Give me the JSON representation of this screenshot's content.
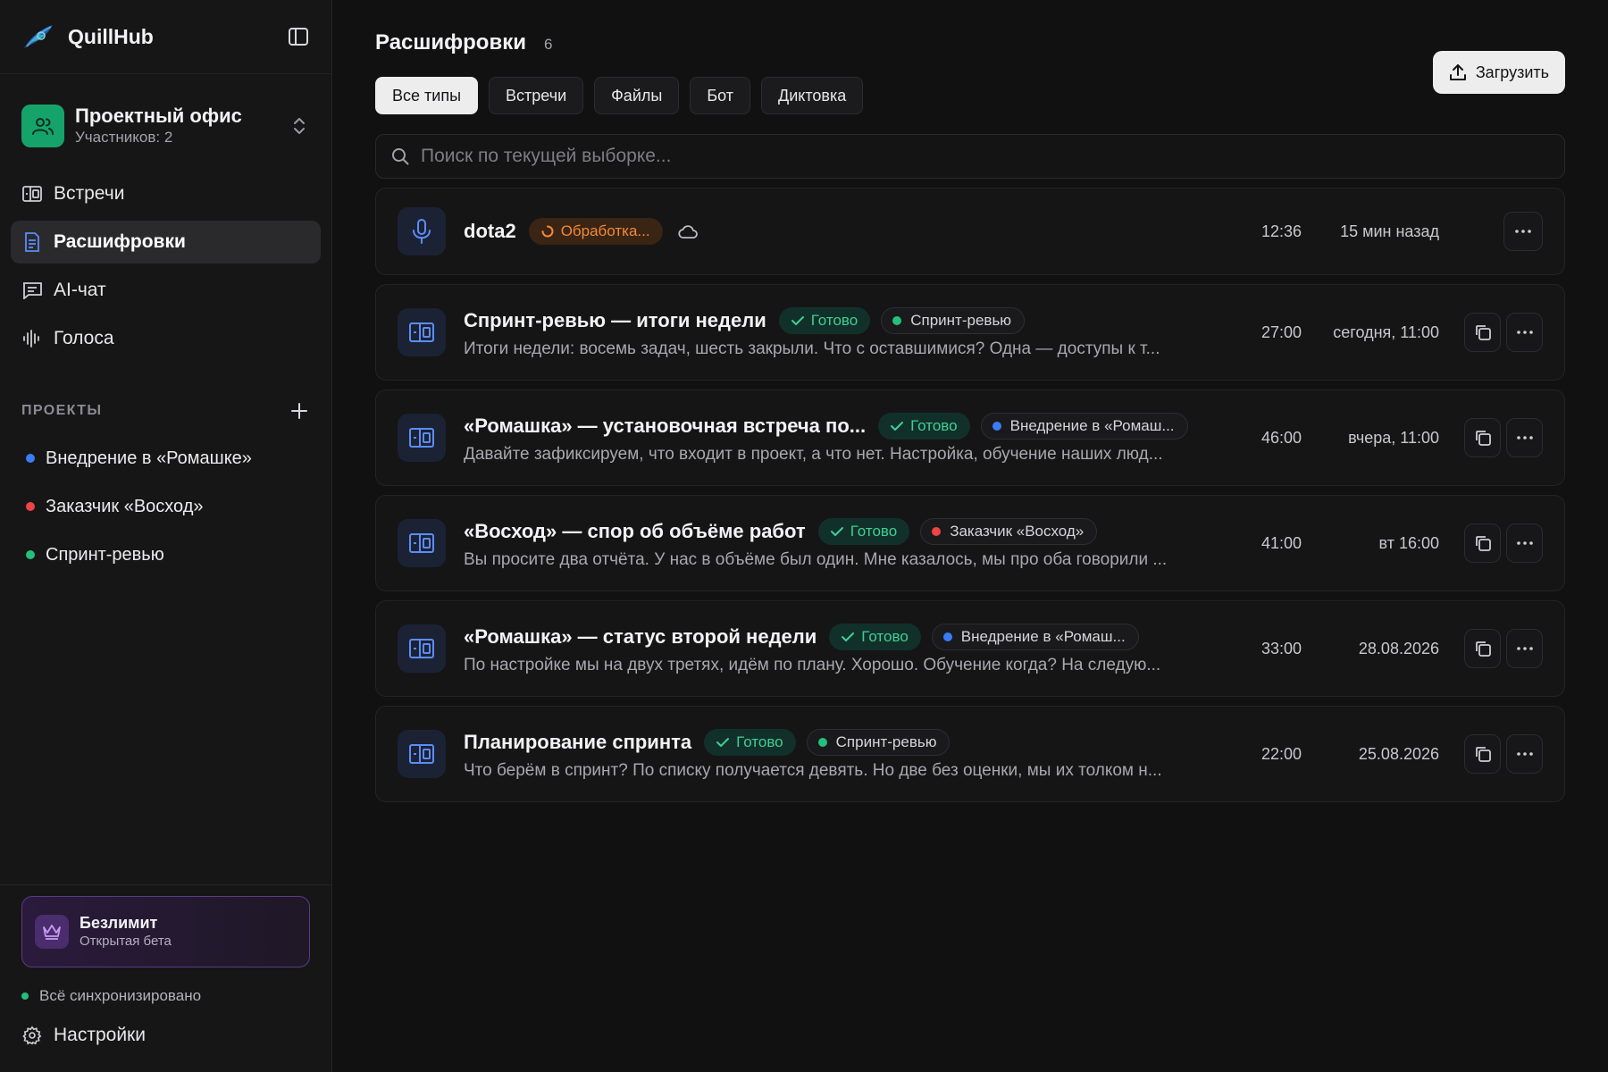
{
  "brand": {
    "name": "QuillHub"
  },
  "workspace": {
    "name": "Проектный офис",
    "members": "Участников: 2"
  },
  "nav": {
    "items": [
      {
        "label": "Встречи",
        "icon": "meetings-icon"
      },
      {
        "label": "Расшифровки",
        "icon": "document-icon",
        "active": true
      },
      {
        "label": "AI-чат",
        "icon": "chat-icon"
      },
      {
        "label": "Голоса",
        "icon": "waveform-icon"
      }
    ]
  },
  "projects": {
    "title": "ПРОЕКТЫ",
    "items": [
      {
        "label": "Внедрение в «Ромашке»",
        "color": "#3b7cf6"
      },
      {
        "label": "Заказчик «Восход»",
        "color": "#ef4444"
      },
      {
        "label": "Спринт-ревью",
        "color": "#22c07a"
      }
    ]
  },
  "plan": {
    "title": "Безлимит",
    "subtitle": "Открытая бета"
  },
  "sync": {
    "label": "Всё синхронизировано",
    "color": "#22c07a"
  },
  "settings": {
    "label": "Настройки"
  },
  "header": {
    "title": "Расшифровки",
    "count": "6"
  },
  "upload": {
    "label": "Загрузить"
  },
  "filters": [
    {
      "label": "Все типы",
      "active": true
    },
    {
      "label": "Встречи"
    },
    {
      "label": "Файлы"
    },
    {
      "label": "Бот"
    },
    {
      "label": "Диктовка"
    }
  ],
  "search": {
    "placeholder": "Поиск по текущей выборке...",
    "value": ""
  },
  "rows": [
    {
      "title": "dota2",
      "icon": "microphone-icon",
      "status": "Обработка...",
      "status_type": "processing",
      "preview": "",
      "duration": "12:36",
      "date": "15 мин назад"
    },
    {
      "title": "Спринт-ревью — итоги недели",
      "icon": "meeting-room-icon",
      "status": "Готово",
      "status_type": "done",
      "project": "Спринт-ревью",
      "project_color": "#22c07a",
      "preview": "Итоги недели: восемь задач, шесть закрыли. Что с оставшимися? Одна — доступы к т...",
      "duration": "27:00",
      "date": "сегодня, 11:00"
    },
    {
      "title": "«Ромашка» — установочная встреча по...",
      "icon": "meeting-room-icon",
      "status": "Готово",
      "status_type": "done",
      "project": "Внедрение в «Ромаш...",
      "project_color": "#3b7cf6",
      "preview": "Давайте зафиксируем, что входит в проект, а что нет. Настройка, обучение наших люд...",
      "duration": "46:00",
      "date": "вчера, 11:00"
    },
    {
      "title": "«Восход» — спор об объёме работ",
      "icon": "meeting-room-icon",
      "status": "Готово",
      "status_type": "done",
      "project": "Заказчик «Восход»",
      "project_color": "#ef4444",
      "preview": "Вы просите два отчёта. У нас в объёме был один. Мне казалось, мы про оба говорили ...",
      "duration": "41:00",
      "date": "вт 16:00"
    },
    {
      "title": "«Ромашка» — статус второй недели",
      "icon": "meeting-room-icon",
      "status": "Готово",
      "status_type": "done",
      "project": "Внедрение в «Ромаш...",
      "project_color": "#3b7cf6",
      "preview": "По настройке мы на двух третях, идём по плану. Хорошо. Обучение когда? На следую...",
      "duration": "33:00",
      "date": "28.08.2026"
    },
    {
      "title": "Планирование спринта",
      "icon": "meeting-room-icon",
      "status": "Готово",
      "status_type": "done",
      "project": "Спринт-ревью",
      "project_color": "#22c07a",
      "preview": "Что берём в спринт? По списку получается девять. Но две без оценки, мы их толком н...",
      "duration": "22:00",
      "date": "25.08.2026"
    }
  ]
}
